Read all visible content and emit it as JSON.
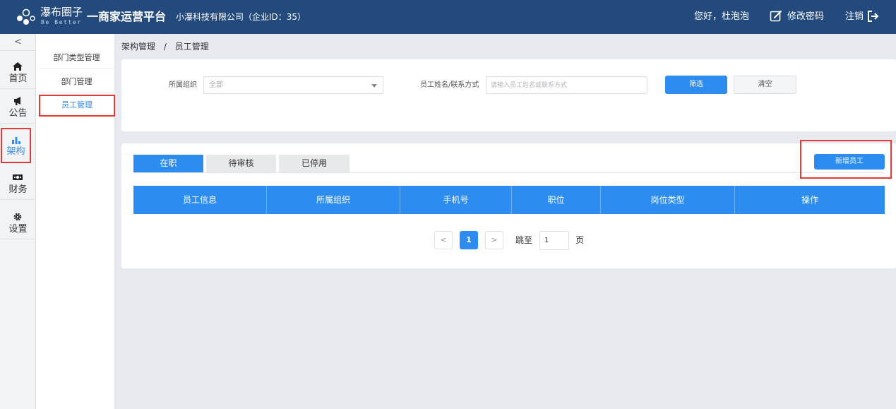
{
  "header": {
    "brand_name": "瀑布圈子",
    "brand_tagline": "Be Better",
    "platform_title": "一商家运营平台",
    "company": "小瀑科技有限公司（企业ID：35）",
    "greeting": "您好，杜泡泡",
    "change_password": "修改密码",
    "logout": "注销"
  },
  "icon_nav": {
    "collapse": "<",
    "items": [
      {
        "label": "首页",
        "icon": "home-icon"
      },
      {
        "label": "公告",
        "icon": "megaphone-icon"
      },
      {
        "label": "架构",
        "icon": "bar-chart-icon"
      },
      {
        "label": "财务",
        "icon": "money-icon"
      },
      {
        "label": "设置",
        "icon": "gear-icon"
      }
    ],
    "active": "架构"
  },
  "sub_nav": {
    "items": [
      {
        "label": "部门类型管理"
      },
      {
        "label": "部门管理"
      },
      {
        "label": "员工管理"
      }
    ],
    "active": "员工管理"
  },
  "breadcrumb": {
    "first": "架构管理",
    "separator": "/",
    "current": "员工管理"
  },
  "filter": {
    "org_label": "所属组织",
    "org_value": "全部",
    "name_label": "员工姓名/联系方式",
    "name_placeholder": "请输入员工姓名或联系方式",
    "filter_button": "筛选",
    "clear_button": "清空"
  },
  "tabs": [
    {
      "label": "在职",
      "active": true
    },
    {
      "label": "待审核",
      "active": false
    },
    {
      "label": "已停用",
      "active": false
    }
  ],
  "add_button": "新增员工",
  "table": {
    "columns": [
      "员工信息",
      "所属组织",
      "手机号",
      "职位",
      "岗位类型",
      "操作"
    ]
  },
  "pagination": {
    "prev": "<",
    "current": "1",
    "next": ">",
    "goto_label": "跳至",
    "goto_value": "1",
    "page_suffix": "页"
  },
  "colors": {
    "header_bg": "#234a7c",
    "primary": "#2d8cf0",
    "highlight_border": "#e53935"
  }
}
